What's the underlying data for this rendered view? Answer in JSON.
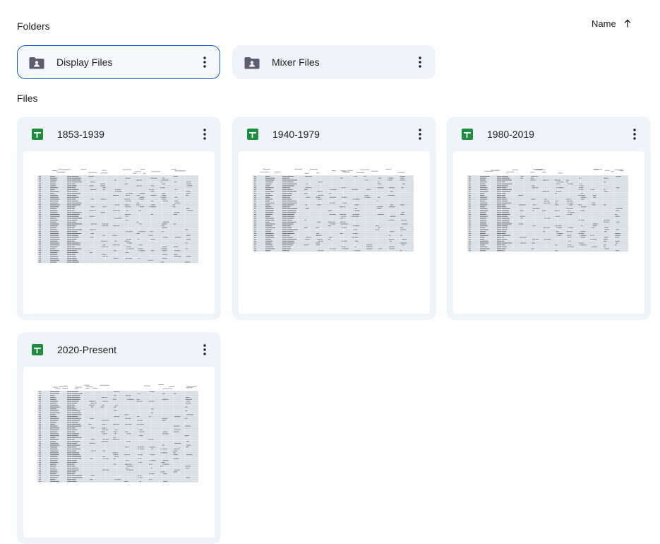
{
  "sections": {
    "folders_label": "Folders",
    "files_label": "Files"
  },
  "sort": {
    "label": "Name",
    "direction_icon": "arrow-up-icon"
  },
  "colors": {
    "folder_icon": "#5f5b73",
    "sheets_green": "#1e8e3e",
    "card_bg": "#eff3fa",
    "selected_border": "#0b57d0"
  },
  "folders": [
    {
      "name": "Display Files",
      "selected": true
    },
    {
      "name": "Mixer Files",
      "selected": false
    }
  ],
  "files": [
    {
      "name": "1853-1939",
      "icon": "google-sheets-icon"
    },
    {
      "name": "1940-1979",
      "icon": "google-sheets-icon"
    },
    {
      "name": "1980-2019",
      "icon": "google-sheets-icon"
    },
    {
      "name": "2020-Present",
      "icon": "google-sheets-icon"
    }
  ]
}
